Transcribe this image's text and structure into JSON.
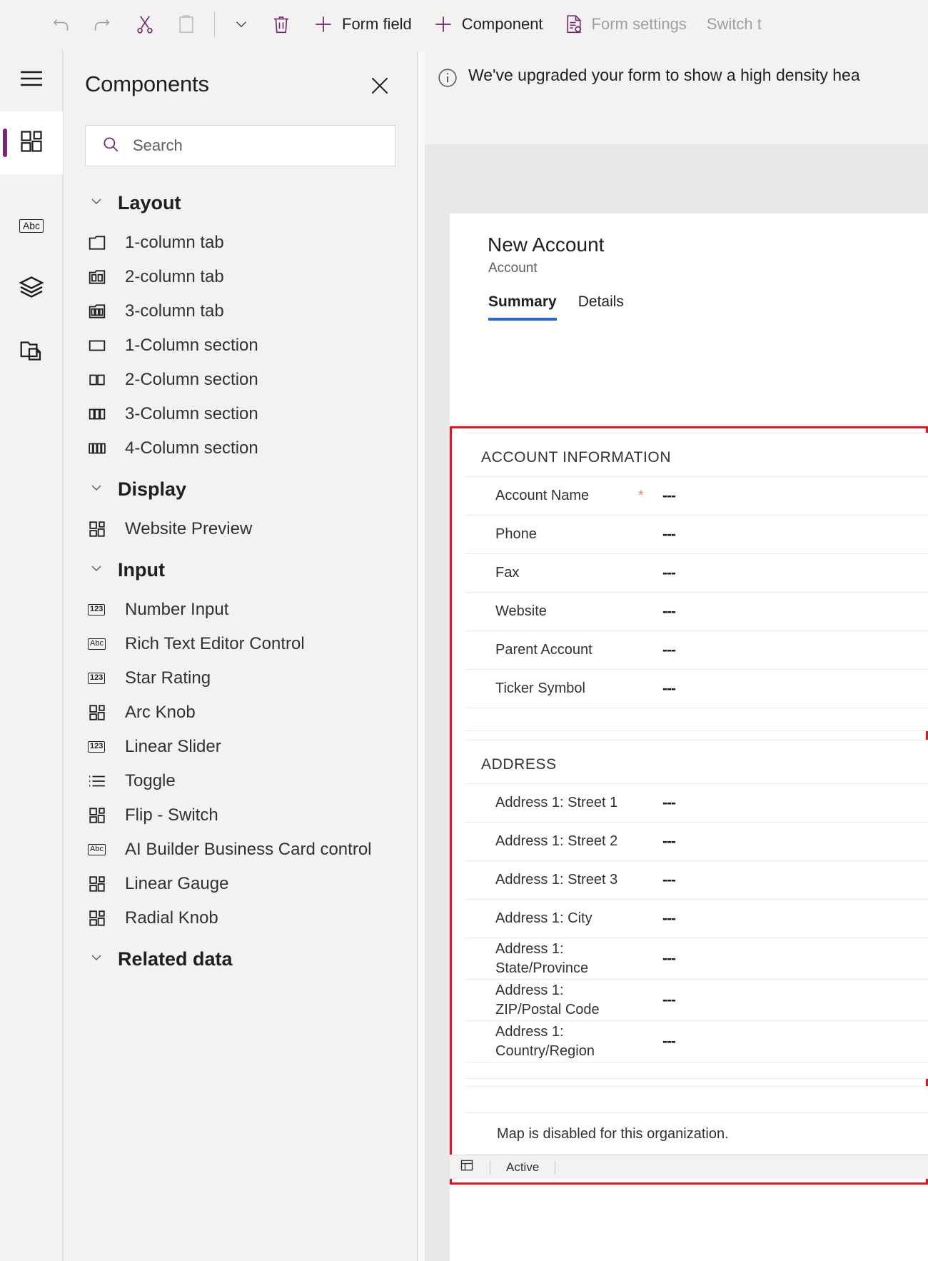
{
  "toolbar": {
    "items": [
      {
        "label": "",
        "icon": "undo-icon",
        "disabled": true
      },
      {
        "label": "",
        "icon": "redo-icon",
        "disabled": true
      },
      {
        "label": "",
        "icon": "cut-icon",
        "disabled": false
      },
      {
        "label": "",
        "icon": "paste-icon",
        "disabled": true
      },
      {
        "label": "",
        "icon": "chevron-down-icon",
        "disabled": false
      },
      {
        "label": "",
        "icon": "delete-icon",
        "disabled": false
      },
      {
        "label": "Form field",
        "icon": "plus-icon",
        "disabled": false
      },
      {
        "label": "Component",
        "icon": "plus-icon",
        "disabled": false
      },
      {
        "label": "Form settings",
        "icon": "form-settings-icon",
        "disabled": true
      },
      {
        "label": "Switch t",
        "icon": "",
        "disabled": true
      }
    ]
  },
  "rail": {
    "items": [
      {
        "name": "hamburger-menu",
        "icon": "hamburger-icon",
        "selected": false
      },
      {
        "name": "components",
        "icon": "components-grid-icon",
        "selected": true
      },
      {
        "name": "tree-view",
        "icon": "abc-icon",
        "label": "Abc",
        "selected": false
      },
      {
        "name": "layers",
        "icon": "layers-icon",
        "selected": false
      },
      {
        "name": "copy-forms",
        "icon": "copy-folder-icon",
        "selected": false
      }
    ]
  },
  "panel": {
    "title": "Components",
    "close_label": "×",
    "search": {
      "placeholder": "Search",
      "value": ""
    },
    "groups": [
      {
        "title": "Layout",
        "expanded": true,
        "items": [
          {
            "label": "1-column tab",
            "icon": "tab-1-column-icon"
          },
          {
            "label": "2-column tab",
            "icon": "tab-2-column-icon"
          },
          {
            "label": "3-column tab",
            "icon": "tab-3-column-icon"
          },
          {
            "label": "1-Column section",
            "icon": "section-1-column-icon"
          },
          {
            "label": "2-Column section",
            "icon": "section-2-column-icon"
          },
          {
            "label": "3-Column section",
            "icon": "section-3-column-icon"
          },
          {
            "label": "4-Column section",
            "icon": "section-4-column-icon"
          }
        ]
      },
      {
        "title": "Display",
        "expanded": true,
        "items": [
          {
            "label": "Website Preview",
            "icon": "component-grid-icon"
          }
        ]
      },
      {
        "title": "Input",
        "expanded": true,
        "items": [
          {
            "label": "Number Input",
            "icon": "number-123-icon"
          },
          {
            "label": "Rich Text Editor Control",
            "icon": "abc-icon"
          },
          {
            "label": "Star Rating",
            "icon": "number-123-icon"
          },
          {
            "label": "Arc Knob",
            "icon": "component-grid-icon"
          },
          {
            "label": "Linear Slider",
            "icon": "number-123-icon"
          },
          {
            "label": "Toggle",
            "icon": "toggle-list-icon"
          },
          {
            "label": "Flip - Switch",
            "icon": "component-grid-icon"
          },
          {
            "label": "AI Builder Business Card control",
            "icon": "abc-icon"
          },
          {
            "label": "Linear Gauge",
            "icon": "component-grid-icon"
          },
          {
            "label": "Radial Knob",
            "icon": "component-grid-icon"
          }
        ]
      },
      {
        "title": "Related data",
        "expanded": true,
        "items": []
      }
    ]
  },
  "canvas": {
    "notification": {
      "icon": "info-icon",
      "text": "We've upgraded your form to show a high density hea"
    },
    "form": {
      "title": "New Account",
      "subtitle": "Account",
      "tabs": [
        {
          "label": "Summary",
          "active": true
        },
        {
          "label": "Details",
          "active": false
        }
      ],
      "sections": [
        {
          "title": "ACCOUNT INFORMATION",
          "fields": [
            {
              "label": "Account Name",
              "required": true,
              "value": "---"
            },
            {
              "label": "Phone",
              "required": false,
              "value": "---"
            },
            {
              "label": "Fax",
              "required": false,
              "value": "---"
            },
            {
              "label": "Website",
              "required": false,
              "value": "---"
            },
            {
              "label": "Parent Account",
              "required": false,
              "value": "---"
            },
            {
              "label": "Ticker Symbol",
              "required": false,
              "value": "---"
            }
          ]
        },
        {
          "title": "ADDRESS",
          "fields": [
            {
              "label": "Address 1: Street 1",
              "required": false,
              "value": "---"
            },
            {
              "label": "Address 1: Street 2",
              "required": false,
              "value": "---"
            },
            {
              "label": "Address 1: Street 3",
              "required": false,
              "value": "---"
            },
            {
              "label": "Address 1: City",
              "required": false,
              "value": "---"
            },
            {
              "label": "Address 1: State/Province",
              "required": false,
              "value": "---"
            },
            {
              "label": "Address 1: ZIP/Postal Code",
              "required": false,
              "value": "---"
            },
            {
              "label": "Address 1: Country/Region",
              "required": false,
              "value": "---"
            }
          ]
        }
      ],
      "map_section": {
        "message": "Map is disabled for this organization."
      },
      "status_bar": {
        "icon": "resize-icon",
        "status": "Active"
      }
    }
  },
  "colors": {
    "accent_purple": "#742774",
    "selection_red": "#e81123",
    "tab_underline_blue": "#2266dd",
    "required_star": "#e8806b",
    "panel_bg": "#f3f2f1",
    "canvas_bg": "#e9e8e7"
  }
}
